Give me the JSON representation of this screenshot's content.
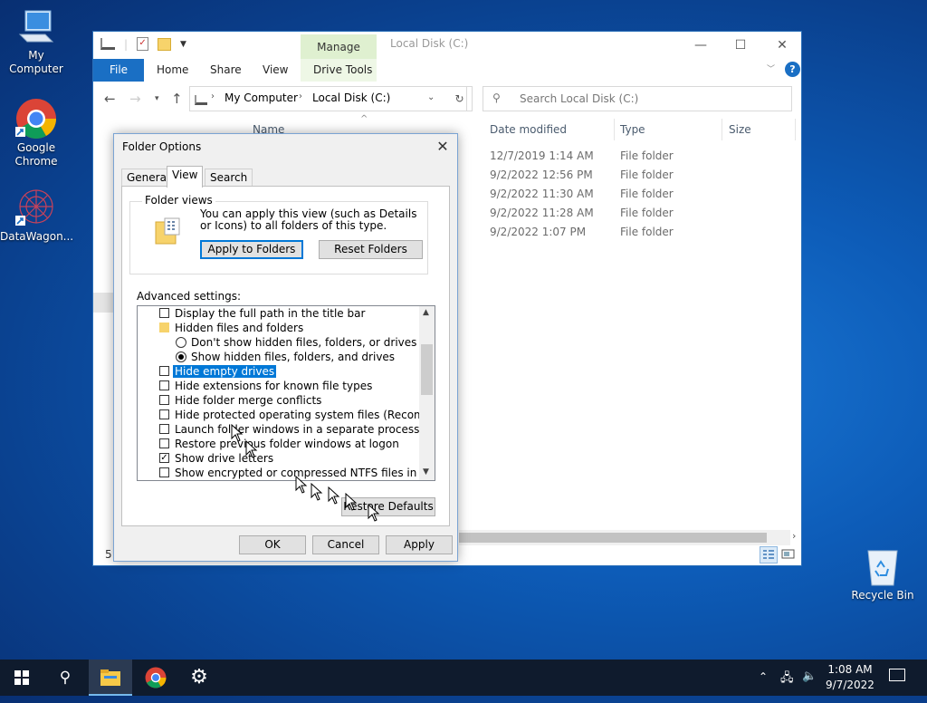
{
  "desktop": {
    "icons": [
      {
        "label": "My Computer"
      },
      {
        "label": "Google Chrome"
      },
      {
        "label": "DataWagon..."
      },
      {
        "label": "Recycle Bin"
      }
    ]
  },
  "explorer": {
    "ribbon": {
      "context_group": "Manage",
      "tabs": [
        "File",
        "Home",
        "Share",
        "View",
        "Drive Tools"
      ]
    },
    "title": "Local Disk (C:)",
    "breadcrumb": [
      "My Computer",
      "Local Disk (C:)"
    ],
    "search_placeholder": "Search Local Disk (C:)",
    "columns": {
      "name": "Name",
      "date": "Date modified",
      "type": "Type",
      "size": "Size"
    },
    "rows": [
      {
        "date": "12/7/2019 1:14 AM",
        "type": "File folder"
      },
      {
        "date": "9/2/2022 12:56 PM",
        "type": "File folder"
      },
      {
        "date": "9/2/2022 11:30 AM",
        "type": "File folder"
      },
      {
        "date": "9/2/2022 11:28 AM",
        "type": "File folder"
      },
      {
        "date": "9/2/2022 1:07 PM",
        "type": "File folder"
      }
    ],
    "status_count": "5"
  },
  "dialog": {
    "title": "Folder Options",
    "tabs": [
      "General",
      "View",
      "Search"
    ],
    "active_tab": "View",
    "folder_views": {
      "label": "Folder views",
      "description": "You can apply this view (such as Details or Icons) to all folders of this type.",
      "apply_button": "Apply to Folders",
      "reset_button": "Reset Folders"
    },
    "advanced_label": "Advanced settings:",
    "settings": [
      {
        "kind": "checkbox",
        "label": "Display the full path in the title bar",
        "checked": false
      },
      {
        "kind": "folder",
        "label": "Hidden files and folders"
      },
      {
        "kind": "radio",
        "label": "Don't show hidden files, folders, or drives",
        "checked": false
      },
      {
        "kind": "radio",
        "label": "Show hidden files, folders, and drives",
        "checked": true
      },
      {
        "kind": "checkbox",
        "label": "Hide empty drives",
        "checked": false,
        "selected": true
      },
      {
        "kind": "checkbox",
        "label": "Hide extensions for known file types",
        "checked": false
      },
      {
        "kind": "checkbox",
        "label": "Hide folder merge conflicts",
        "checked": false
      },
      {
        "kind": "checkbox",
        "label": "Hide protected operating system files (Recommended)",
        "checked": false
      },
      {
        "kind": "checkbox",
        "label": "Launch folder windows in a separate process",
        "checked": false
      },
      {
        "kind": "checkbox",
        "label": "Restore previous folder windows at logon",
        "checked": false
      },
      {
        "kind": "checkbox",
        "label": "Show drive letters",
        "checked": true
      },
      {
        "kind": "checkbox",
        "label": "Show encrypted or compressed NTFS files in color",
        "checked": false
      }
    ],
    "restore_defaults": "Restore Defaults",
    "ok": "OK",
    "cancel": "Cancel",
    "apply": "Apply"
  },
  "taskbar": {
    "time": "1:08 AM",
    "date": "9/7/2022"
  },
  "colors": {
    "accent": "#0078d7",
    "file_tab": "#1a6fc4",
    "manage_tab": "#dff0d0",
    "taskbar": "#0f1b2d"
  }
}
